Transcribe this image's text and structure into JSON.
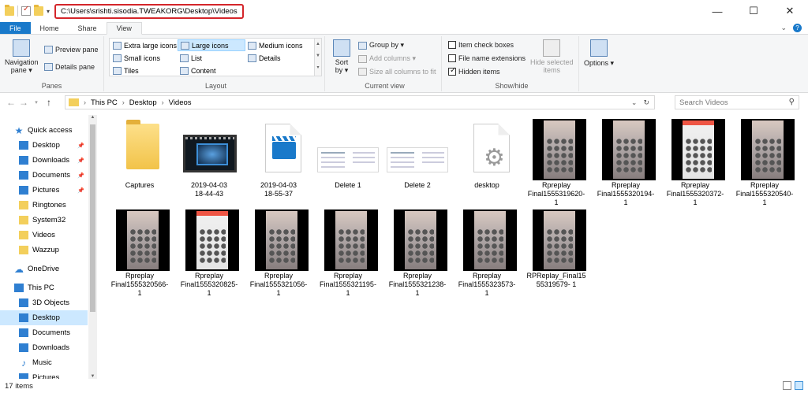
{
  "titlebar": {
    "path": "C:\\Users\\srishti.sisodia.TWEAKORG\\Desktop\\Videos",
    "minimize_glyph": "—",
    "maximize_glyph": "☐",
    "close_glyph": "✕"
  },
  "ribbon_tabs": [
    "File",
    "Home",
    "Share",
    "View"
  ],
  "ribbon_help_glyphs": {
    "expand": "⌄",
    "help": "?"
  },
  "ribbon": {
    "panes": {
      "label": "Panes",
      "navigation_pane": "Navigation\npane ▾",
      "preview_pane": "Preview pane",
      "details_pane": "Details pane"
    },
    "layout": {
      "label": "Layout",
      "items": [
        "Extra large icons",
        "Large icons",
        "Medium icons",
        "Small icons",
        "List",
        "Details",
        "Tiles",
        "Content"
      ],
      "selected": "Large icons"
    },
    "current_view": {
      "label": "Current view",
      "sort_by": "Sort\nby ▾",
      "group_by": "Group by ▾",
      "add_columns": "Add columns ▾",
      "size_columns": "Size all columns to fit"
    },
    "show_hide": {
      "label": "Show/hide",
      "item_check_boxes": "Item check boxes",
      "file_name_extensions": "File name extensions",
      "hidden_items": "Hidden items",
      "hide_selected": "Hide selected\nitems"
    },
    "options": {
      "label": "Options ▾"
    }
  },
  "address": {
    "crumbs": [
      "This PC",
      "Desktop",
      "Videos"
    ],
    "search_placeholder": "Search Videos"
  },
  "navpane": {
    "items": [
      {
        "label": "Quick access",
        "icon": "star-icon",
        "pinned": false
      },
      {
        "label": "Desktop",
        "icon": "desktop-icon",
        "pinned": true
      },
      {
        "label": "Downloads",
        "icon": "downloads-icon",
        "pinned": true
      },
      {
        "label": "Documents",
        "icon": "documents-icon",
        "pinned": true
      },
      {
        "label": "Pictures",
        "icon": "pictures-icon",
        "pinned": true
      },
      {
        "label": "Ringtones",
        "icon": "folder-icon",
        "pinned": false
      },
      {
        "label": "System32",
        "icon": "folder-icon",
        "pinned": false
      },
      {
        "label": "Videos",
        "icon": "folder-icon",
        "pinned": false
      },
      {
        "label": "Wazzup",
        "icon": "folder-icon",
        "pinned": false
      },
      {
        "label": "OneDrive",
        "icon": "cloud-icon",
        "pinned": false
      },
      {
        "label": "This PC",
        "icon": "computer-icon",
        "pinned": false
      },
      {
        "label": "3D Objects",
        "icon": "cube-icon",
        "pinned": false
      },
      {
        "label": "Desktop",
        "icon": "desktop-icon",
        "pinned": false
      },
      {
        "label": "Documents",
        "icon": "documents-icon",
        "pinned": false
      },
      {
        "label": "Downloads",
        "icon": "downloads-icon",
        "pinned": false
      },
      {
        "label": "Music",
        "icon": "music-icon",
        "pinned": false
      },
      {
        "label": "Pictures",
        "icon": "pictures-icon",
        "pinned": false
      }
    ]
  },
  "files": [
    {
      "name": "Captures",
      "kind": "folder"
    },
    {
      "name": "2019-04-03\n18-44-43",
      "kind": "video"
    },
    {
      "name": "2019-04-03\n18-55-37",
      "kind": "clip"
    },
    {
      "name": "Delete 1",
      "kind": "screenshot"
    },
    {
      "name": "Delete 2",
      "kind": "screenshot"
    },
    {
      "name": "desktop",
      "kind": "settings"
    },
    {
      "name": "Rpreplay\nFinal1555319620-\n1",
      "kind": "phone"
    },
    {
      "name": "Rpreplay\nFinal1555320194-\n1",
      "kind": "phone"
    },
    {
      "name": "Rpreplay\nFinal1555320372-\n1",
      "kind": "phone-light"
    },
    {
      "name": "Rpreplay\nFinal1555320540-\n1",
      "kind": "phone"
    },
    {
      "name": "Rpreplay\nFinal1555320566-\n1",
      "kind": "phone"
    },
    {
      "name": "Rpreplay\nFinal1555320825-\n1",
      "kind": "phone-light"
    },
    {
      "name": "Rpreplay\nFinal1555321056-\n1",
      "kind": "phone"
    },
    {
      "name": "Rpreplay\nFinal1555321195-\n1",
      "kind": "phone"
    },
    {
      "name": "Rpreplay\nFinal1555321238-\n1",
      "kind": "phone"
    },
    {
      "name": "Rpreplay\nFinal1555323573-\n1",
      "kind": "phone"
    },
    {
      "name": "RPReplay_Final15\n55319579- 1",
      "kind": "phone"
    }
  ],
  "status": {
    "count": "17 items"
  },
  "colors": {
    "accent": "#1979ca",
    "selection": "#cce8ff",
    "highlight_border": "#d4252a"
  }
}
